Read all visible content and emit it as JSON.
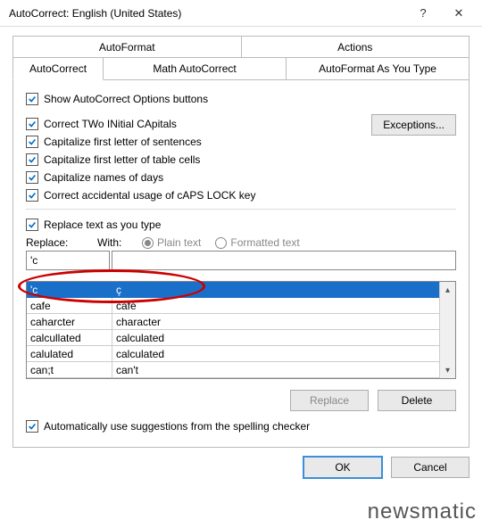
{
  "title": "AutoCorrect: English (United States)",
  "titlebar": {
    "help": "?",
    "close": "✕"
  },
  "tabs_top": [
    "AutoFormat",
    "Actions"
  ],
  "tabs_bottom": [
    "AutoCorrect",
    "Math AutoCorrect",
    "AutoFormat As You Type"
  ],
  "active_tab": "AutoCorrect",
  "checks": {
    "show_buttons": "Show AutoCorrect Options buttons",
    "two_initial": "Correct TWo INitial CApitals",
    "first_sentence": "Capitalize first letter of sentences",
    "first_table": "Capitalize first letter of table cells",
    "days": "Capitalize names of days",
    "capslock": "Correct accidental usage of cAPS LOCK key",
    "replace_as_type": "Replace text as you type",
    "auto_suggest": "Automatically use suggestions from the spelling checker"
  },
  "labels": {
    "replace": "Replace:",
    "with": "With:",
    "plain": "Plain text",
    "formatted": "Formatted text",
    "exceptions": "Exceptions...",
    "replace_btn": "Replace",
    "delete_btn": "Delete",
    "ok": "OK",
    "cancel": "Cancel"
  },
  "inputs": {
    "replace_val": "'c",
    "with_val": ""
  },
  "entries": [
    {
      "r": "'c",
      "w": "ç",
      "sel": true
    },
    {
      "r": "cafe",
      "w": "café"
    },
    {
      "r": "caharcter",
      "w": "character"
    },
    {
      "r": "calcullated",
      "w": "calculated"
    },
    {
      "r": "calulated",
      "w": "calculated"
    },
    {
      "r": "can;t",
      "w": "can't"
    }
  ],
  "watermark": "newsmatic"
}
